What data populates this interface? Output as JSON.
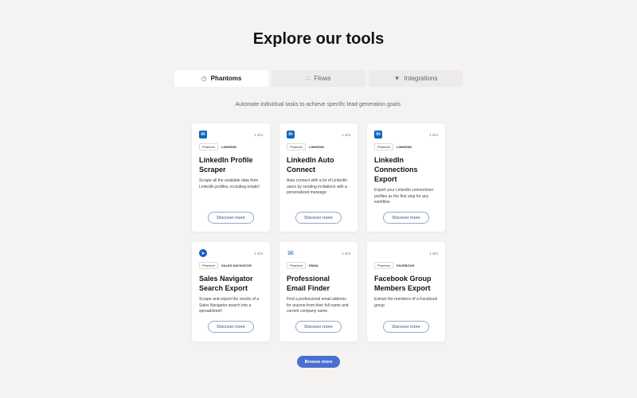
{
  "header": {
    "title": "Explore our tools"
  },
  "tabs": [
    {
      "label": "Phantoms",
      "icon": "clock-icon",
      "glyph": "◷",
      "active": true
    },
    {
      "label": "Flows",
      "icon": "flow-icon",
      "glyph": "∴",
      "active": false
    },
    {
      "label": "Integrations",
      "icon": "plug-icon",
      "glyph": "▼",
      "active": false
    }
  ],
  "subtitle": "Automate individual tasks to achieve specific lead generation goals.",
  "cards": [
    {
      "logo": "linkedin-logo",
      "logo_text": "in",
      "slots": "1 slot",
      "tags": [
        "Phantom",
        "LINKEDIN"
      ],
      "title": "LinkedIn Profile Scraper",
      "description": "Scrape all the available data from LinkedIn profiles, including emails!",
      "button": "Discover more"
    },
    {
      "logo": "linkedin-logo",
      "logo_text": "in",
      "slots": "1 slot",
      "tags": [
        "Phantom",
        "LINKEDIN"
      ],
      "title": "LinkedIn Auto Connect",
      "description": "Auto connect with a lot of LinkedIn users by sending invitations with a personalized message",
      "button": "Discover more"
    },
    {
      "logo": "linkedin-logo",
      "logo_text": "in",
      "slots": "1 slot",
      "tags": [
        "Phantom",
        "LINKEDIN"
      ],
      "title": "LinkedIn Connections Export",
      "description": "Export your LinkedIn connections' profiles as the first step for any workflow",
      "button": "Discover more"
    },
    {
      "logo": "sales-navigator-logo",
      "logo_text": "➤",
      "slots": "1 slot",
      "tags": [
        "Phantom",
        "SALES NAVIGATOR"
      ],
      "title": "Sales Navigator Search Export",
      "description": "Scrape and export the results of a Sales Navigator search into a spreadsheet!",
      "button": "Discover more"
    },
    {
      "logo": "email-logo",
      "logo_text": "✉",
      "slots": "1 slot",
      "tags": [
        "Phantom",
        "EMAIL"
      ],
      "title": "Professional Email Finder",
      "description": "Find a professional email address for anyone from their full name and current company name",
      "button": "Discover more"
    },
    {
      "logo": "facebook-logo",
      "logo_text": "",
      "slots": "1 slot",
      "tags": [
        "Phantom",
        "FACEBOOK"
      ],
      "title": "Facebook Group Members Export",
      "description": "Extract the members of a Facebook group",
      "button": "Discover more"
    }
  ],
  "browse_button": "Browse more",
  "colors": {
    "background": "#f5f3f1",
    "linkedin": "#0a66c2",
    "accent": "#4a6fd3",
    "button_border": "#9aa6c8"
  }
}
